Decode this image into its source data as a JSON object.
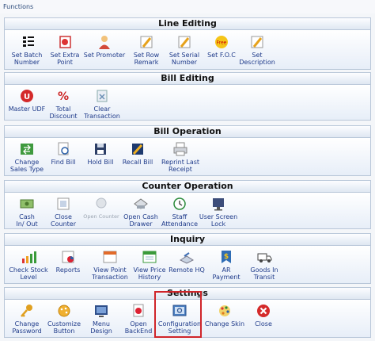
{
  "window": {
    "title": "Functions"
  },
  "sections": [
    {
      "title": "Line Editing",
      "buttons": [
        "Set Batch\nNumber",
        "Set Extra\nPoint",
        "Set Promoter",
        "Set Row\nRemark",
        "Set Serial\nNumber",
        "Set F.O.C",
        "Set\nDescription"
      ]
    },
    {
      "title": "Bill Editing",
      "buttons": [
        "Master UDF",
        "Total\nDiscount",
        "Clear\nTransaction"
      ]
    },
    {
      "title": "Bill Operation",
      "buttons": [
        "Change\nSales Type",
        "Find Bill",
        "Hold Bill",
        "Recall Bill",
        "Reprint Last\nReceipt"
      ]
    },
    {
      "title": "Counter Operation",
      "buttons": [
        "Cash\nIn/ Out",
        "Close\nCounter",
        "Open Counter",
        "Open Cash\nDrawer",
        "Staff\nAttendance",
        "User Screen\nLock"
      ]
    },
    {
      "title": "Inquiry",
      "buttons": [
        "Check Stock\nLevel",
        "Reports",
        "View Point\nTransaction",
        "View Price\nHistory",
        "Remote HQ",
        "AR\nPayment",
        "Goods In\nTransit"
      ]
    },
    {
      "title": "Settings",
      "buttons": [
        "Change\nPassword",
        "Customize\nButton",
        "Menu\nDesign",
        "Open\nBackEnd",
        "Configuration\nSetting",
        "Change Skin",
        "Close"
      ]
    }
  ],
  "icons": {
    "line": [
      "list-icon",
      "extra-point-icon",
      "promoter-icon",
      "row-remark-icon",
      "serial-number-icon",
      "foc-icon",
      "description-icon"
    ],
    "bill": [
      "udf-icon",
      "percent-icon",
      "clear-icon"
    ],
    "billop": [
      "change-sales-type-icon",
      "find-bill-icon",
      "hold-bill-icon",
      "recall-bill-icon",
      "printer-icon"
    ],
    "counter": [
      "cash-icon",
      "close-counter-icon",
      "open-counter-icon",
      "cash-drawer-icon",
      "attendance-icon",
      "screen-lock-icon"
    ],
    "inquiry": [
      "stock-level-icon",
      "reports-icon",
      "point-transaction-icon",
      "price-history-icon",
      "remote-hq-icon",
      "ar-payment-icon",
      "goods-transit-icon"
    ],
    "settings": [
      "password-key-icon",
      "customize-button-icon",
      "menu-design-icon",
      "backend-icon",
      "configuration-icon",
      "change-skin-icon",
      "close-icon"
    ]
  },
  "badges": {
    "foc": "Free",
    "ar": "$"
  },
  "disabled": [
    "Open Counter"
  ],
  "highlighted": "Configuration Setting"
}
